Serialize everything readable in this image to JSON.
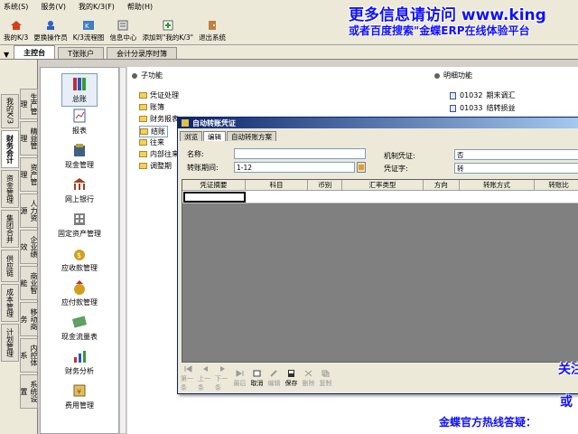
{
  "menubar": {
    "items": [
      "系统(S)",
      "服务(V)",
      "我的K/3(F)",
      "帮助(H)"
    ]
  },
  "toolbar": {
    "buttons": [
      "我的K/3",
      "更换操作员",
      "K/3流程图",
      "信息中心",
      "添加到\"我的K/3\"",
      "退出系统"
    ]
  },
  "tabs": [
    "主控台",
    "T张账户",
    "会计分录序时簿"
  ],
  "promo": {
    "line1": "更多信息请访问 www.king",
    "line2": "或者百度搜索\"金蝶ERP在线体验平台"
  },
  "vnav": {
    "col1": [
      "我的K/3",
      "财务会计",
      "资金管理",
      "集团合并",
      "供应链",
      "成本管理",
      "计划管理"
    ],
    "col2": [
      "生产管理",
      "精益管理",
      "资产管理",
      "人力资源",
      "企业绩效",
      "商业智能",
      "移动商务",
      "内控体系",
      "系统设置"
    ]
  },
  "modules": [
    "总账",
    "报表",
    "现金管理",
    "网上银行",
    "固定资产管理",
    "应收款管理",
    "应付款管理",
    "现金流量表",
    "财务分析",
    "费用管理"
  ],
  "subfunc": {
    "title": "子功能",
    "items": [
      "凭证处理",
      "账簿",
      "财务报表",
      "结账",
      "往来",
      "内部往来",
      "调整期"
    ]
  },
  "detail": {
    "title": "明细功能",
    "items": [
      {
        "code": "01032",
        "name": "期末调汇"
      },
      {
        "code": "01033",
        "name": "结转损益"
      }
    ]
  },
  "dialog": {
    "title": "自动转账凭证",
    "tabs": [
      "浏览",
      "编辑",
      "自动转账方案"
    ],
    "fields": {
      "name_label": "名称:",
      "name_value": "",
      "period_label": "转账期间:",
      "period_value": "1-12",
      "mech_label": "机制凭证:",
      "mech_value": "否",
      "word_label": "凭证字:",
      "word_value": "转"
    },
    "grid_headers": [
      "凭证摘要",
      "科目",
      "币别",
      "汇率类型",
      "方向",
      "转账方式",
      "转账比"
    ],
    "toolbar": [
      "第一条",
      "上一条",
      "下一条",
      "最后",
      "取消",
      "编辑",
      "保存",
      "删除",
      "复制"
    ]
  },
  "overlay": {
    "right1": "关注",
    "right2": "或",
    "hotline": "金蝶官方热线答疑："
  },
  "colors": {
    "accent": "#1010ff",
    "title_bar": "#0a246a"
  }
}
